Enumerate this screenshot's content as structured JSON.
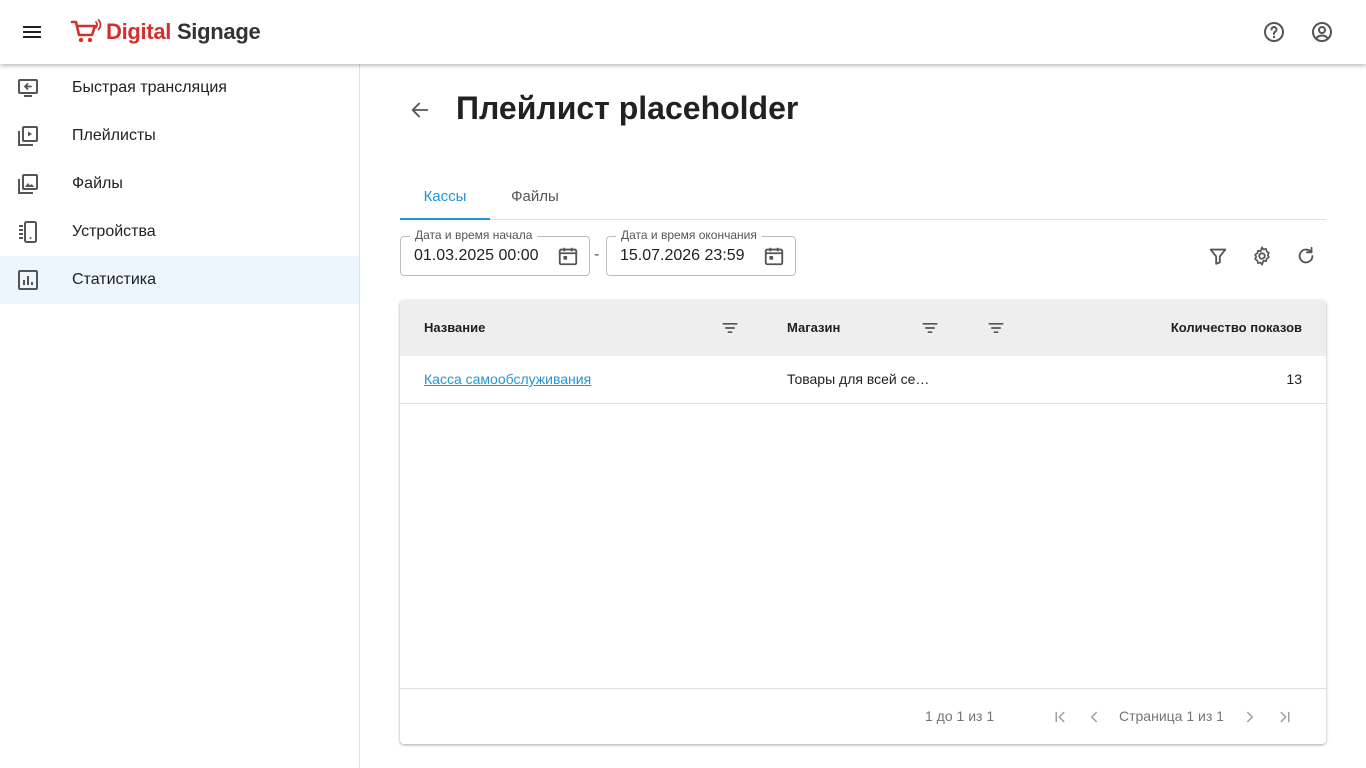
{
  "header": {
    "logo_text_red": "Digital",
    "logo_text_dark": "Signage",
    "brand_color": "#d32f2f",
    "icons": [
      "menu-icon",
      "help-icon",
      "account-icon"
    ]
  },
  "sidebar": {
    "items": [
      {
        "label": "Быстрая трансляция",
        "icon": "quick-broadcast-icon"
      },
      {
        "label": "Плейлисты",
        "icon": "playlist-icon"
      },
      {
        "label": "Файлы",
        "icon": "files-icon"
      },
      {
        "label": "Устройства",
        "icon": "devices-icon"
      },
      {
        "label": "Статистика",
        "icon": "statistics-icon",
        "active": true
      }
    ]
  },
  "main": {
    "title": "Плейлист placeholder",
    "tabs": [
      {
        "label": "Кассы",
        "active": true
      },
      {
        "label": "Файлы",
        "active": false
      }
    ],
    "date_start": {
      "label": "Дата и время начала",
      "value": "01.03.2025 00:00"
    },
    "date_separator": "-",
    "date_end": {
      "label": "Дата и время окончания",
      "value": "15.07.2026 23:59"
    },
    "accent_color": "#2196d3"
  },
  "table": {
    "columns": [
      "Название",
      "Магазин",
      "Количество показов"
    ],
    "rows": [
      {
        "name": "Касса самообслуживания",
        "store": "Товары для всей се…",
        "count": "13"
      }
    ]
  },
  "pagination": {
    "summary": "1 до 1 из 1",
    "page_text": "Страница 1 из 1"
  }
}
